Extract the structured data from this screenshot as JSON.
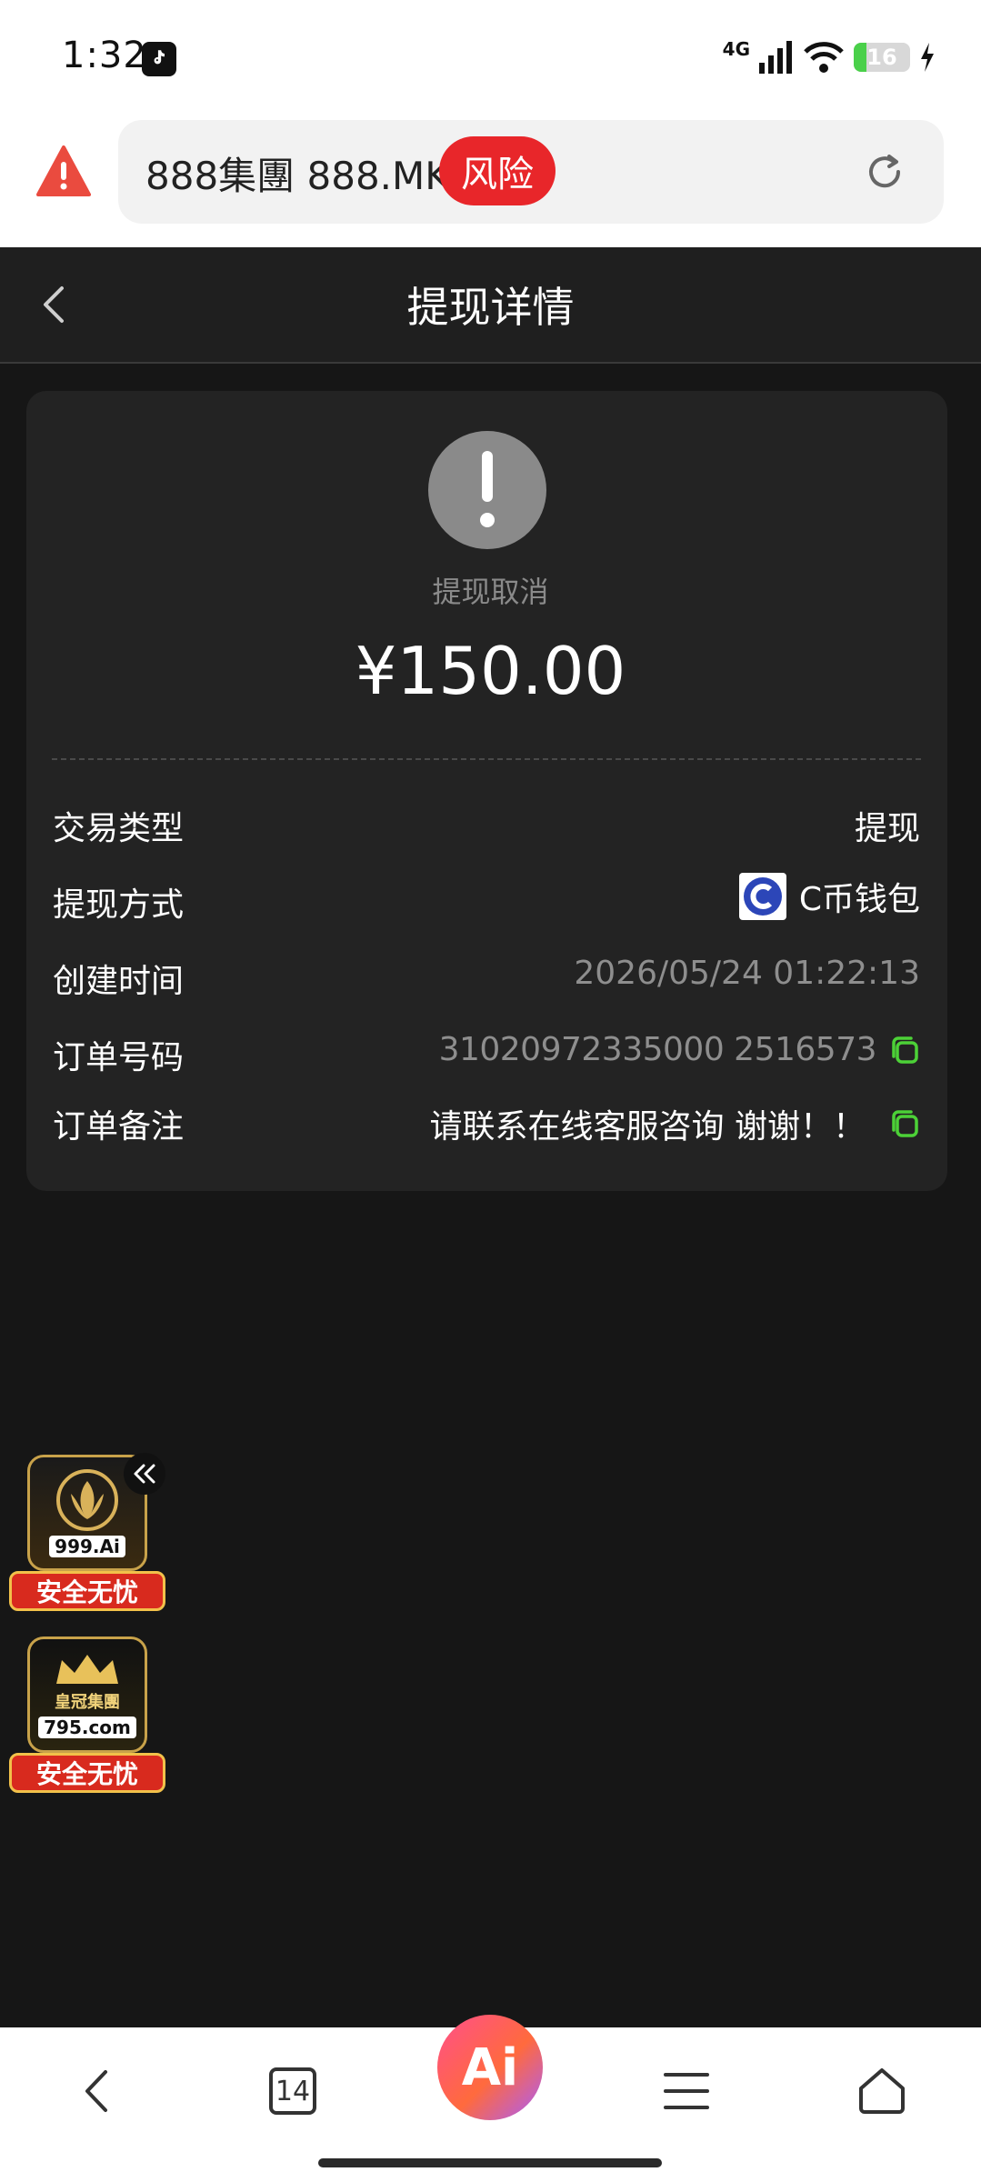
{
  "status_bar": {
    "time": "1:32",
    "network": "4G",
    "battery": "16",
    "battery_fraction": 0.16
  },
  "browser": {
    "url": "888集團 888.MK",
    "risk_label": "风险",
    "open_tabs": "14",
    "ai_label": "Ai"
  },
  "header": {
    "title": "提现详情"
  },
  "detail": {
    "status": "提现取消",
    "amount": "¥150.00",
    "rows": [
      {
        "label": "交易类型",
        "value": "提现"
      },
      {
        "label": "提现方式",
        "value": "C币钱包"
      },
      {
        "label": "创建时间",
        "value": "2026/05/24 01:22:13"
      },
      {
        "label": "订单号码",
        "value": "31020972335000 2516573"
      },
      {
        "label": "订单备注",
        "value": "请联系在线客服咨询 谢谢！！"
      }
    ]
  },
  "ads": [
    {
      "caption": "999.Ai",
      "ribbon": "安全无忧"
    },
    {
      "name": "皇冠集團",
      "caption": "795.com",
      "ribbon": "安全无忧"
    }
  ],
  "colors": {
    "background": "#161616",
    "card": "#232323",
    "risk": "#e8262a",
    "copy_icon": "#4cd137",
    "muted_text": "#8e8e8e"
  }
}
